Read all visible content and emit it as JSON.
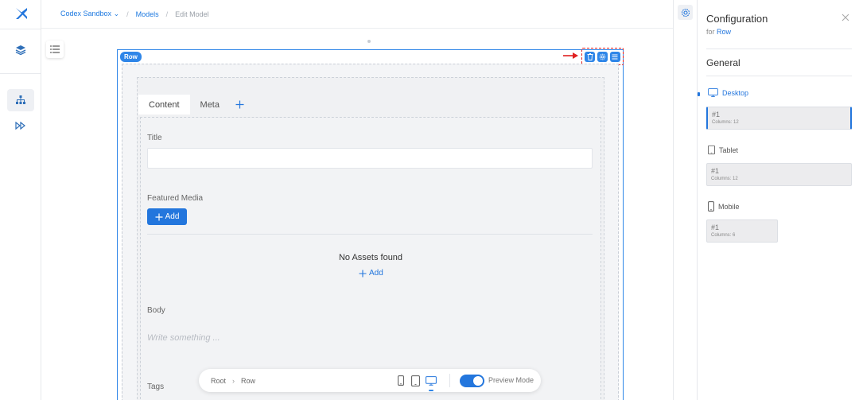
{
  "breadcrumb": {
    "workspace": "Codex Sandbox",
    "section": "Models",
    "current": "Edit Model"
  },
  "canvas": {
    "row_badge": "Row",
    "tabs": [
      {
        "label": "Content",
        "active": true
      },
      {
        "label": "Meta",
        "active": false
      }
    ],
    "fields": {
      "title_label": "Title",
      "featured_media_label": "Featured Media",
      "add_button": "Add",
      "no_assets_text": "No Assets found",
      "add_link": "Add",
      "body_label": "Body",
      "body_placeholder": "Write something ...",
      "tags_label": "Tags"
    }
  },
  "bottom_bar": {
    "path_root": "Root",
    "path_current": "Row",
    "devices": [
      "mobile-icon",
      "tablet-icon",
      "desktop-icon"
    ],
    "active_device": "desktop",
    "preview_label": "Preview Mode",
    "preview_on": true
  },
  "panel": {
    "title": "Configuration",
    "subtitle_prefix": "for",
    "subtitle_target": "Row",
    "section": "General",
    "breakpoints": [
      {
        "name": "Desktop",
        "item": "#1",
        "columns": "Columns: 12",
        "active": true
      },
      {
        "name": "Tablet",
        "item": "#1",
        "columns": "Columns: 12",
        "active": false
      },
      {
        "name": "Mobile",
        "item": "#1",
        "columns": "Columns: 6",
        "active": false
      }
    ]
  },
  "colors": {
    "accent": "#2376dd",
    "highlight": "#e02020"
  }
}
